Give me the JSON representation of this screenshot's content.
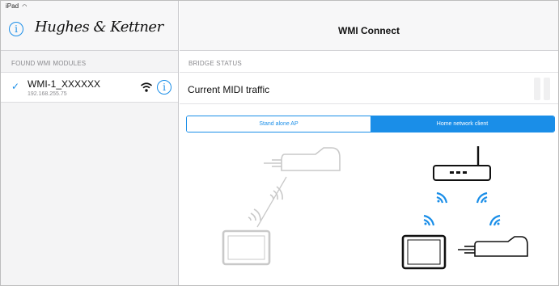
{
  "status_bar": {
    "device": "iPad"
  },
  "left_pane": {
    "logo_text": "Hughes & Kettner",
    "section_label": "FOUND WMI MODULES",
    "modules": [
      {
        "name": "WMI-1_XXXXXX",
        "ip": "192.168.255.75",
        "selected": true
      }
    ]
  },
  "right_pane": {
    "title": "WMI Connect",
    "section_label": "BRIDGE STATUS",
    "midi_label": "Current MIDI traffic",
    "modes": [
      {
        "label": "Stand alone AP",
        "selected": false
      },
      {
        "label": "Home network client",
        "selected": true
      }
    ]
  },
  "colors": {
    "accent": "#1a8ee8",
    "inactive_diagram": "#c9c9c9",
    "active_diagram": "#111111"
  },
  "icons": {
    "check": "✓",
    "info": "i",
    "wifi": "wifi-icon",
    "router": "router-icon",
    "tablet": "tablet-icon",
    "amp_module": "wmi-module-icon"
  }
}
